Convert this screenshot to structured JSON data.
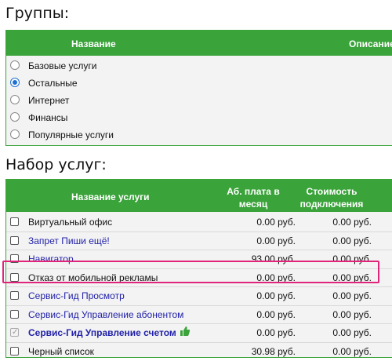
{
  "groups": {
    "title": "Группы:",
    "columns": {
      "name": "Название",
      "description": "Описание"
    },
    "items": [
      {
        "label": "Базовые услуги",
        "selected": false
      },
      {
        "label": "Остальные",
        "selected": true
      },
      {
        "label": "Интернет",
        "selected": false
      },
      {
        "label": "Финансы",
        "selected": false
      },
      {
        "label": "Популярные услуги",
        "selected": false
      }
    ]
  },
  "services": {
    "title": "Набор услуг:",
    "columns": {
      "name": "Название услуги",
      "fee_line1": "Аб. плата в",
      "fee_line2": "месяц",
      "conn_line1": "Стоимость",
      "conn_line2": "подключения"
    },
    "rows": [
      {
        "name": "Виртуальный офис",
        "fee": "0.00 руб.",
        "conn": "0.00 руб.",
        "style": "plain",
        "checked": false
      },
      {
        "name": "Запрет Пиши ещё!",
        "fee": "0.00 руб.",
        "conn": "0.00 руб.",
        "style": "link",
        "checked": false
      },
      {
        "name": "Навигатор",
        "fee": "93.00 руб.",
        "conn": "0.00 руб.",
        "style": "link",
        "checked": false
      },
      {
        "name": "Отказ от мобильной рекламы",
        "fee": "0.00 руб.",
        "conn": "0.00 руб.",
        "style": "plain",
        "checked": false,
        "highlighted": true
      },
      {
        "name": "Сервис-Гид Просмотр",
        "fee": "0.00 руб.",
        "conn": "0.00 руб.",
        "style": "link",
        "checked": false
      },
      {
        "name": "Сервис-Гид Управление абонентом",
        "fee": "0.00 руб.",
        "conn": "0.00 руб.",
        "style": "link",
        "checked": false
      },
      {
        "name": "Сервис-Гид Управление счетом",
        "fee": "0.00 руб.",
        "conn": "0.00 руб.",
        "style": "bold",
        "checked": true,
        "disabled": true,
        "icon": "thumbs-up-icon"
      },
      {
        "name": "Черный список",
        "fee": "30.98 руб.",
        "conn": "0.00 руб.",
        "style": "plain",
        "checked": false
      }
    ]
  },
  "colors": {
    "header_green": "#3aa33a",
    "highlight": "#e0247a",
    "link": "#2222aa",
    "radio_selected": "#1f6fd1"
  }
}
